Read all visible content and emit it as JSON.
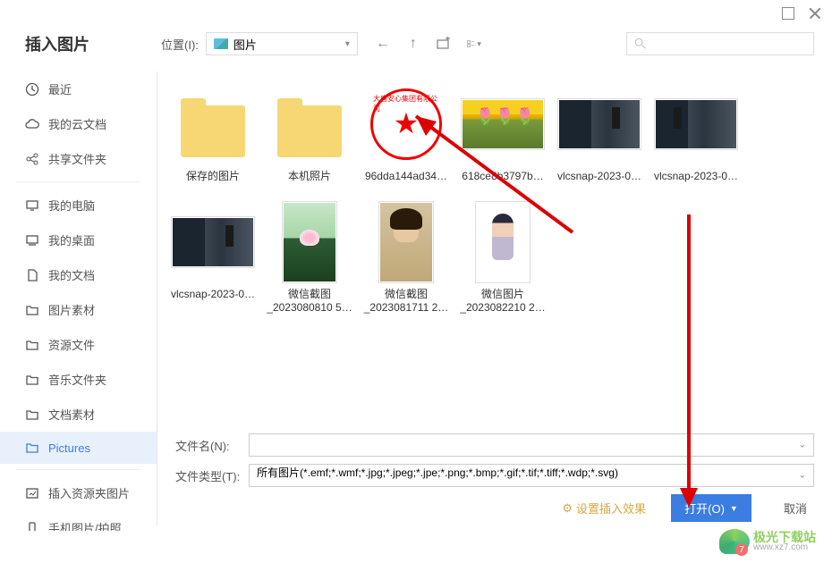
{
  "dialog_title": "插入图片",
  "location": {
    "label": "位置(I):",
    "value": "图片"
  },
  "search": {
    "placeholder": ""
  },
  "sidebar": {
    "groups": [
      [
        {
          "icon": "clock",
          "label": "最近"
        },
        {
          "icon": "cloud",
          "label": "我的云文档"
        },
        {
          "icon": "share",
          "label": "共享文件夹"
        }
      ],
      [
        {
          "icon": "monitor",
          "label": "我的电脑"
        },
        {
          "icon": "desktop",
          "label": "我的桌面"
        },
        {
          "icon": "doc",
          "label": "我的文档"
        },
        {
          "icon": "folder",
          "label": "图片素材"
        },
        {
          "icon": "folder",
          "label": "资源文件"
        },
        {
          "icon": "folder",
          "label": "音乐文件夹"
        },
        {
          "icon": "folder",
          "label": "文档素材"
        },
        {
          "icon": "folder",
          "label": "Pictures",
          "selected": true
        }
      ],
      [
        {
          "icon": "insert",
          "label": "插入资源夹图片"
        },
        {
          "icon": "phone",
          "label": "手机图片/拍照"
        }
      ]
    ]
  },
  "files": [
    {
      "type": "folder",
      "name": "保存的图片"
    },
    {
      "type": "folder",
      "name": "本机照片"
    },
    {
      "type": "stamp",
      "name": "96dda144ad34…",
      "stamp_text": "大唐安心集团有限公司"
    },
    {
      "type": "tulips",
      "name": "618ce8b3797b…",
      "shape": "wide"
    },
    {
      "type": "vlc1",
      "name": "vlcsnap-2023-0…",
      "shape": "wide"
    },
    {
      "type": "vlc2",
      "name": "vlcsnap-2023-0…",
      "shape": "wide"
    },
    {
      "type": "vlc1",
      "name": "vlcsnap-2023-0…",
      "shape": "wide"
    },
    {
      "type": "lotus",
      "name": "微信截图_2023080810 5…",
      "shape": "tall",
      "two": true
    },
    {
      "type": "portrait",
      "name": "微信截图_2023081711 2…",
      "shape": "tall",
      "two": true
    },
    {
      "type": "sitting",
      "name": "微信图片_2023082210 2…",
      "shape": "tall",
      "two": true
    }
  ],
  "footer": {
    "filename_label": "文件名(N):",
    "filename_value": "",
    "filetype_label": "文件类型(T):",
    "filetype_value": "所有图片(*.emf;*.wmf;*.jpg;*.jpeg;*.jpe;*.png;*.bmp;*.gif;*.tif;*.tiff;*.wdp;*.svg)",
    "insert_effect": "设置插入效果",
    "open_label": "打开(O)",
    "cancel_label": "取消"
  },
  "watermark": {
    "name": "极光下载站",
    "url": "www.xz7.com"
  }
}
